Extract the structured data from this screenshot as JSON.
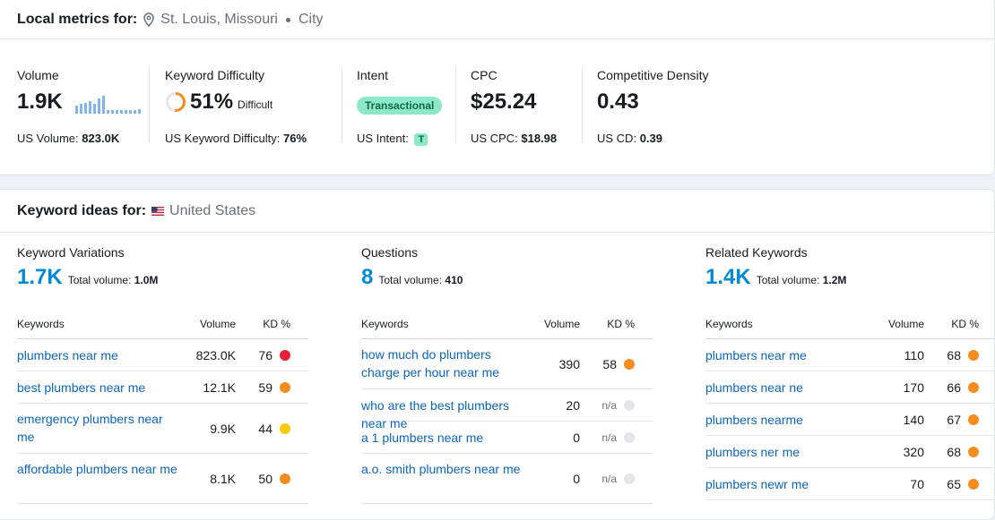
{
  "local": {
    "label": "Local metrics for:",
    "location": "St. Louis, Missouri",
    "type": "City"
  },
  "metrics": {
    "volume": {
      "title": "Volume",
      "value": "1.9K",
      "sub_label": "US Volume:",
      "sub_value": "823.0K",
      "trend": [
        0.45,
        0.55,
        0.6,
        0.7,
        0.55,
        0.85,
        1.0,
        0.2,
        0.2,
        0.2,
        0.2,
        0.2,
        0.2,
        0.2,
        0.25
      ]
    },
    "kd": {
      "title": "Keyword Difficulty",
      "value": "51%",
      "level": "Difficult",
      "sub_label": "US Keyword Difficulty:",
      "sub_value": "76%",
      "percent": 51
    },
    "intent": {
      "title": "Intent",
      "value": "Transactional",
      "sub_label": "US Intent:",
      "badge": "T"
    },
    "cpc": {
      "title": "CPC",
      "value": "$25.24",
      "sub_label": "US CPC:",
      "sub_value": "$18.98"
    },
    "cd": {
      "title": "Competitive Density",
      "value": "0.43",
      "sub_label": "US CD:",
      "sub_value": "0.39"
    }
  },
  "ideas": {
    "label": "Keyword ideas for:",
    "country": "United States",
    "headers": {
      "keywords": "Keywords",
      "volume": "Volume",
      "kd": "KD %"
    },
    "columns": [
      {
        "title": "Keyword Variations",
        "count": "1.7K",
        "total_label": "Total volume:",
        "total_value": "1.0M",
        "rows": [
          {
            "kw": "plumbers near me",
            "vol": "823.0K",
            "kd": "76",
            "color": "#e8203a"
          },
          {
            "kw": "best plumbers near me",
            "vol": "12.1K",
            "kd": "59",
            "color": "#f58c1e"
          },
          {
            "kw": "emergency plumbers near me",
            "vol": "9.9K",
            "kd": "44",
            "color": "#f9c90c"
          },
          {
            "kw": "affordable plumbers near me",
            "vol": "8.1K",
            "kd": "50",
            "color": "#f58c1e"
          }
        ]
      },
      {
        "title": "Questions",
        "count": "8",
        "total_label": "Total volume:",
        "total_value": "410",
        "rows": [
          {
            "kw": "how much do plumbers charge per hour near me",
            "vol": "390",
            "kd": "58",
            "color": "#f58c1e"
          },
          {
            "kw": "who are the best plumbers near me",
            "vol": "20",
            "kd": "n/a",
            "color": "#e4e5ea"
          },
          {
            "kw": "a 1 plumbers near me",
            "vol": "0",
            "kd": "n/a",
            "color": "#e4e5ea"
          },
          {
            "kw": "a.o. smith plumbers near me",
            "vol": "0",
            "kd": "n/a",
            "color": "#e4e5ea"
          }
        ]
      },
      {
        "title": "Related Keywords",
        "count": "1.4K",
        "total_label": "Total volume:",
        "total_value": "1.2M",
        "rows": [
          {
            "kw": "plumbers near me",
            "vol": "110",
            "kd": "68",
            "color": "#f58c1e"
          },
          {
            "kw": "plumbers near ne",
            "vol": "170",
            "kd": "66",
            "color": "#f58c1e"
          },
          {
            "kw": "plumbers nearme",
            "vol": "140",
            "kd": "67",
            "color": "#f58c1e"
          },
          {
            "kw": "plumbers ner me",
            "vol": "320",
            "kd": "68",
            "color": "#f58c1e"
          },
          {
            "kw": "plumbers newr me",
            "vol": "70",
            "kd": "65",
            "color": "#f58c1e"
          }
        ]
      }
    ]
  }
}
